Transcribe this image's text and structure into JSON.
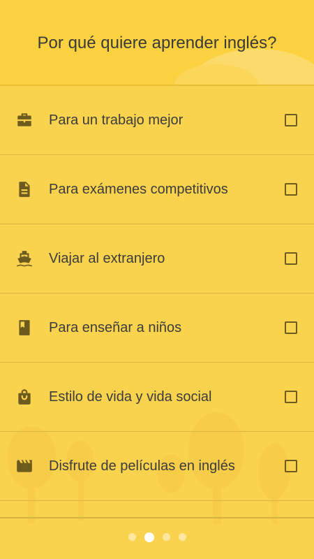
{
  "header": {
    "title": "Por qué quiere aprender inglés?"
  },
  "options": [
    {
      "label": "Para un trabajo mejor",
      "icon": "briefcase-icon",
      "checked": false
    },
    {
      "label": "Para exámenes competitivos",
      "icon": "document-icon",
      "checked": false
    },
    {
      "label": "Viajar al extranjero",
      "icon": "ship-icon",
      "checked": false
    },
    {
      "label": "Para enseñar a niños",
      "icon": "book-icon",
      "checked": false
    },
    {
      "label": "Estilo de vida y vida social",
      "icon": "shopping-bag-icon",
      "checked": false
    },
    {
      "label": "Disfrute de películas en inglés",
      "icon": "clapperboard-icon",
      "checked": false
    }
  ],
  "pagination": {
    "pages": 4,
    "active_page": 2
  },
  "colors": {
    "background": "#f9d24e",
    "header": "#fbd13f",
    "icon": "#6d5b1e",
    "text": "#3c3c3c"
  }
}
